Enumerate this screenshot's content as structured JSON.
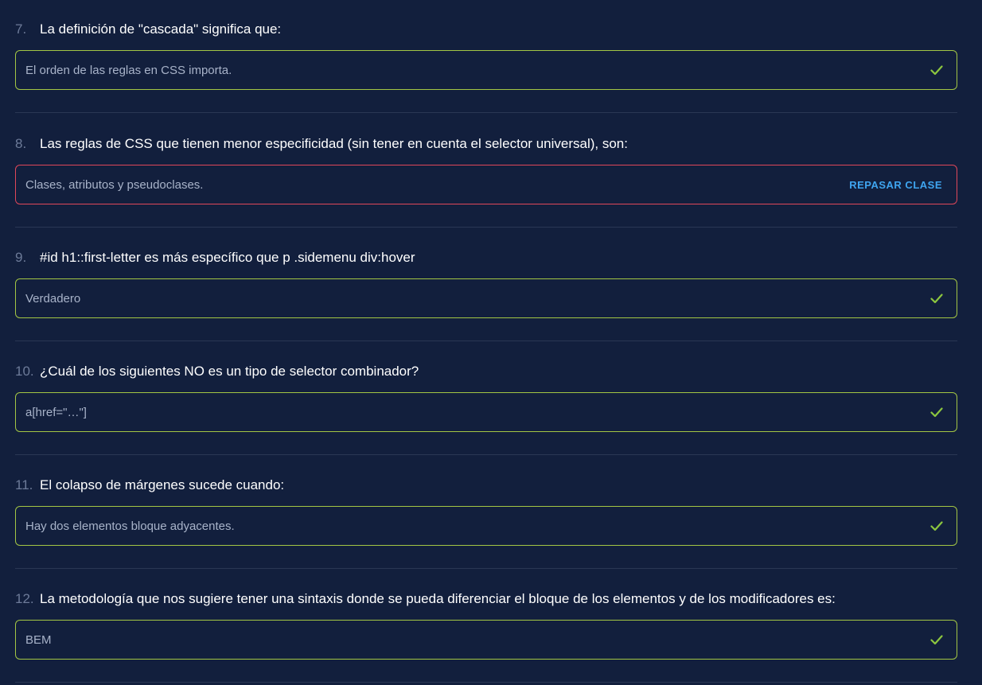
{
  "questions": [
    {
      "number": "7.",
      "text": "La definición de \"cascada\" significa que:",
      "answer": "El orden de las reglas en CSS importa.",
      "status": "correct"
    },
    {
      "number": "8.",
      "text": "Las reglas de CSS que tienen menor especificidad (sin tener en cuenta el selector universal), son:",
      "answer": "Clases, atributos y pseudoclases.",
      "status": "incorrect",
      "review_label": "REPASAR CLASE"
    },
    {
      "number": "9.",
      "text": "#id h1::first-letter es más específico que p .sidemenu div:hover",
      "answer": "Verdadero",
      "status": "correct"
    },
    {
      "number": "10.",
      "text": "¿Cuál de los siguientes NO es un tipo de selector combinador?",
      "answer": "a[href=\"…\"]",
      "status": "correct"
    },
    {
      "number": "11.",
      "text": "El colapso de márgenes sucede cuando:",
      "answer": "Hay dos elementos bloque adyacentes.",
      "status": "correct"
    },
    {
      "number": "12.",
      "text": "La metodología que nos sugiere tener una sintaxis donde se pueda diferenciar el bloque de los elementos y de los modificadores es:",
      "answer": "BEM",
      "status": "correct"
    }
  ],
  "icons": {
    "correct": "check-icon"
  },
  "colors": {
    "background": "#121f3d",
    "correct_border": "#a3c644",
    "incorrect_border": "#e0475a",
    "check": "#8cc63f",
    "review_link": "#3fa5f0"
  }
}
